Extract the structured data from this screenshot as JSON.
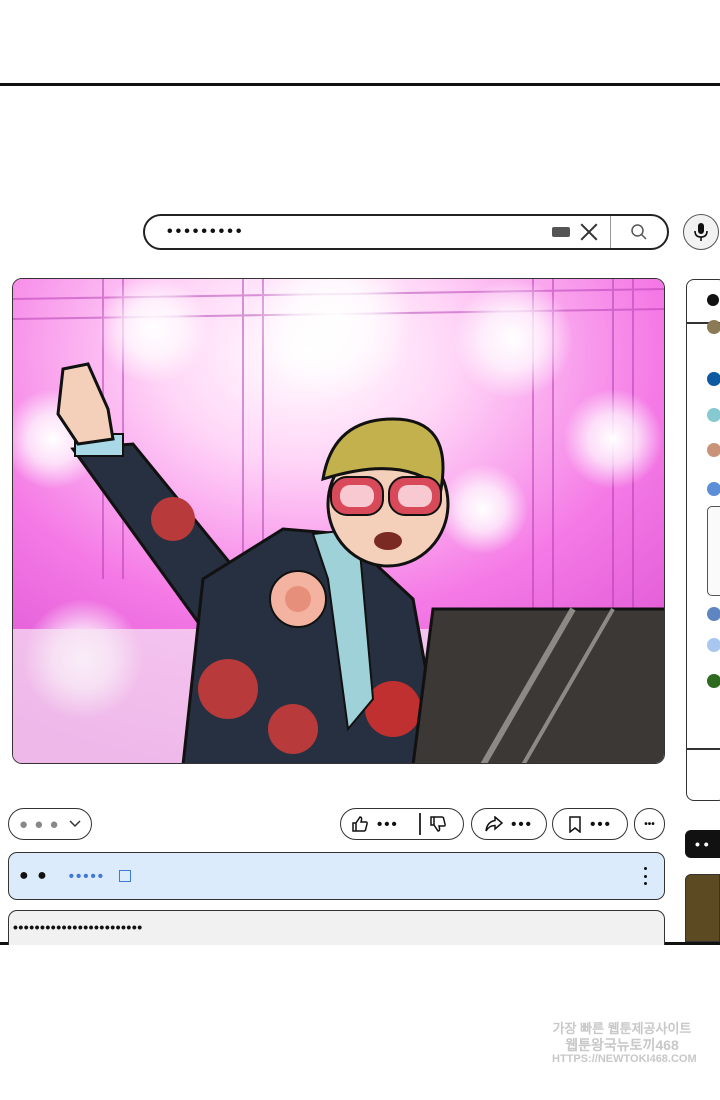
{
  "search": {
    "query": "•••••••••"
  },
  "video": {
    "description": "comic illustration of a performer in glasses pointing up at a pink-lit stage beside a piano"
  },
  "actions": {
    "channel_pill": "● ● ●",
    "like_label": "•••",
    "share_label": "•••",
    "save_label": "•••",
    "more_label": "•••"
  },
  "info": {
    "name": "● ●",
    "link": "•••••"
  },
  "description": {
    "text": "••••••••••••••••••••••••"
  },
  "sidebar": {
    "chip": "• •"
  },
  "watermark": {
    "line1": "가장 빠른 웹툰제공사이트",
    "line2": "웹툰왕국뉴토끼468",
    "line3": "HTTPS://NEWTOKI468.COM"
  },
  "colors": {
    "sidebar_dots": [
      "#8a7a55",
      "#0d5aa0",
      "#87c9d0",
      "#c9937a",
      "#5b8ed6",
      "#5f86c0",
      "#a9c7ee",
      "#2e6a20"
    ],
    "info_bg": "#dcebfb",
    "link": "#3f7ad6"
  }
}
